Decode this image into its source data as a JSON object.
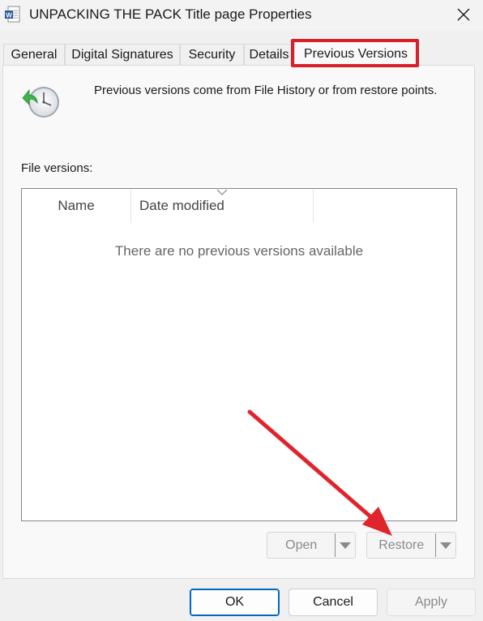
{
  "window": {
    "title": "UNPACKING THE PACK Title page Properties",
    "app_icon": "word-document-icon",
    "close_icon": "close-icon"
  },
  "tabs": [
    {
      "label": "General",
      "active": false
    },
    {
      "label": "Digital Signatures",
      "active": false
    },
    {
      "label": "Security",
      "active": false
    },
    {
      "label": "Details",
      "active": false
    },
    {
      "label": "Previous Versions",
      "active": true
    }
  ],
  "content": {
    "icon": "clock-restore-icon",
    "description": "Previous versions come from File History or from restore points.",
    "file_versions_label": "File versions:",
    "columns": [
      "Name",
      "Date modified"
    ],
    "empty_message": "There are no previous versions available"
  },
  "actions": {
    "open_label": "Open",
    "restore_label": "Restore"
  },
  "buttons": {
    "ok": "OK",
    "cancel": "Cancel",
    "apply": "Apply"
  },
  "colors": {
    "highlight": "#d6202a",
    "accent": "#0067c0"
  }
}
